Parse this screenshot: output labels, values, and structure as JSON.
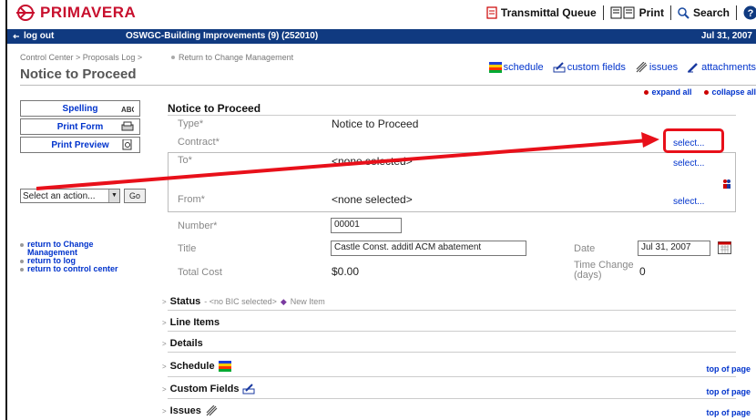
{
  "app": {
    "name": "PRIMAVERA"
  },
  "toplinks": [
    {
      "label": "Transmittal Queue",
      "icon": "document-icon"
    },
    {
      "label": "Print",
      "icon": "print-icon"
    },
    {
      "label": "Search",
      "icon": "search-icon"
    }
  ],
  "bluebar": {
    "logout": "log out",
    "project": "OSWGC-Building Improvements (9) (252010)",
    "date": "Jul 31, 2007"
  },
  "header": {
    "breadcrumb": "Control Center > Proposals Log >",
    "return_link": "Return to Change Management",
    "title": "Notice to Proceed",
    "tools": [
      "schedule",
      "custom fields",
      "issues",
      "attachments"
    ],
    "expand_all": "expand all",
    "collapse_all": "collapse all"
  },
  "left": {
    "buttons": [
      "Spelling",
      "Print Form",
      "Print Preview"
    ],
    "action_select": "Select an action...",
    "go": "Go",
    "links": [
      "return to Change Management",
      "return to log",
      "return to control center"
    ]
  },
  "form": {
    "title": "Notice to Proceed",
    "type_label": "Type*",
    "type_value": "Notice to Proceed",
    "contract_label": "Contract*",
    "to_label": "To*",
    "to_value": "<none selected>",
    "from_label": "From*",
    "from_value": "<none selected>",
    "select_link": "select...",
    "number_label": "Number*",
    "number_value": "00001",
    "title_label": "Title",
    "title_value": "Castle Const. additl ACM abatement",
    "date_label": "Date",
    "date_value": "Jul 31, 2007",
    "total_cost_label": "Total Cost",
    "total_cost_value": "$0.00",
    "time_change_label": "Time Change (days)",
    "time_change_value": "0"
  },
  "sections": {
    "status": "Status",
    "status_sub": "- <no BIC selected>",
    "status_new": "New Item",
    "line_items": "Line Items",
    "details": "Details",
    "schedule": "Schedule",
    "custom_fields": "Custom Fields",
    "issues": "Issues",
    "top_of_page": "top of page"
  },
  "colors": {
    "brand": "#c8102e",
    "nav": "#103a80",
    "link": "#0033cc",
    "highlight": "#e8101a"
  }
}
